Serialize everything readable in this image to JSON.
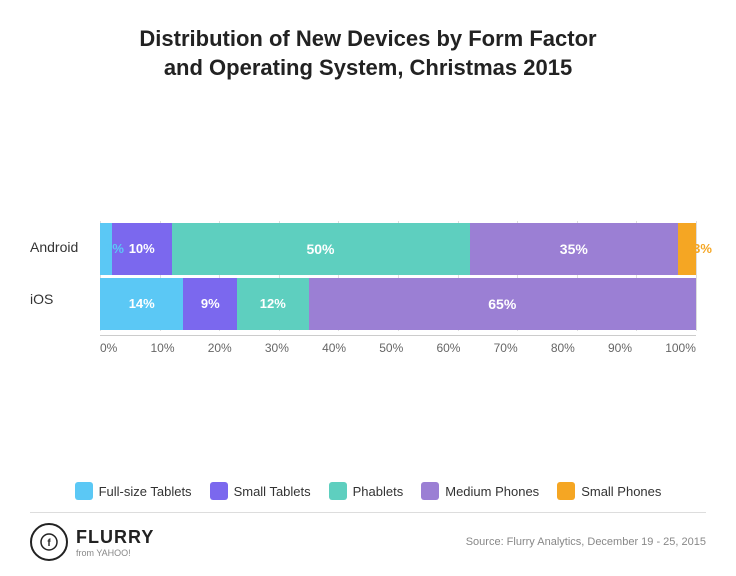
{
  "title": {
    "line1": "Distribution of New Devices by Form Factor",
    "line2": "and Operating System, Christmas 2015"
  },
  "chart": {
    "android": {
      "label": "Android",
      "segments": [
        {
          "id": "full-tablets",
          "value": 2,
          "label": "2%",
          "color": "#5BC8F5",
          "outside": true
        },
        {
          "id": "small-tablets",
          "value": 10,
          "label": "10%",
          "color": "#7B68EE"
        },
        {
          "id": "phablets",
          "value": 50,
          "label": "50%",
          "color": "#5ECFBF"
        },
        {
          "id": "medium-phones",
          "value": 35,
          "label": "35%",
          "color": "#9B7FD4"
        },
        {
          "id": "small-phones",
          "value": 3,
          "label": "3%",
          "color": "#F5A623",
          "outside": true
        }
      ]
    },
    "ios": {
      "label": "iOS",
      "segments": [
        {
          "id": "full-tablets",
          "value": 14,
          "label": "14%",
          "color": "#5BC8F5"
        },
        {
          "id": "small-tablets",
          "value": 9,
          "label": "9%",
          "color": "#7B68EE"
        },
        {
          "id": "phablets",
          "value": 12,
          "label": "12%",
          "color": "#5ECFBF"
        },
        {
          "id": "medium-phones",
          "value": 65,
          "label": "65%",
          "color": "#9B7FD4"
        }
      ]
    }
  },
  "xaxis": {
    "labels": [
      "0%",
      "10%",
      "20%",
      "30%",
      "40%",
      "50%",
      "60%",
      "70%",
      "80%",
      "90%",
      "100%"
    ]
  },
  "legend": [
    {
      "id": "full-tablets",
      "label": "Full-size Tablets",
      "color": "#5BC8F5"
    },
    {
      "id": "small-tablets",
      "label": "Small Tablets",
      "color": "#7B68EE"
    },
    {
      "id": "phablets",
      "label": "Phablets",
      "color": "#5ECFBF"
    },
    {
      "id": "medium-phones",
      "label": "Medium Phones",
      "color": "#9B7FD4"
    },
    {
      "id": "small-phones",
      "label": "Small Phones",
      "color": "#F5A623"
    }
  ],
  "footer": {
    "logo_initials": "f",
    "logo_name": "FLURRY",
    "logo_sub": "from YAHOO!",
    "source": "Source: Flurry Analytics, December 19 - 25, 2015"
  }
}
